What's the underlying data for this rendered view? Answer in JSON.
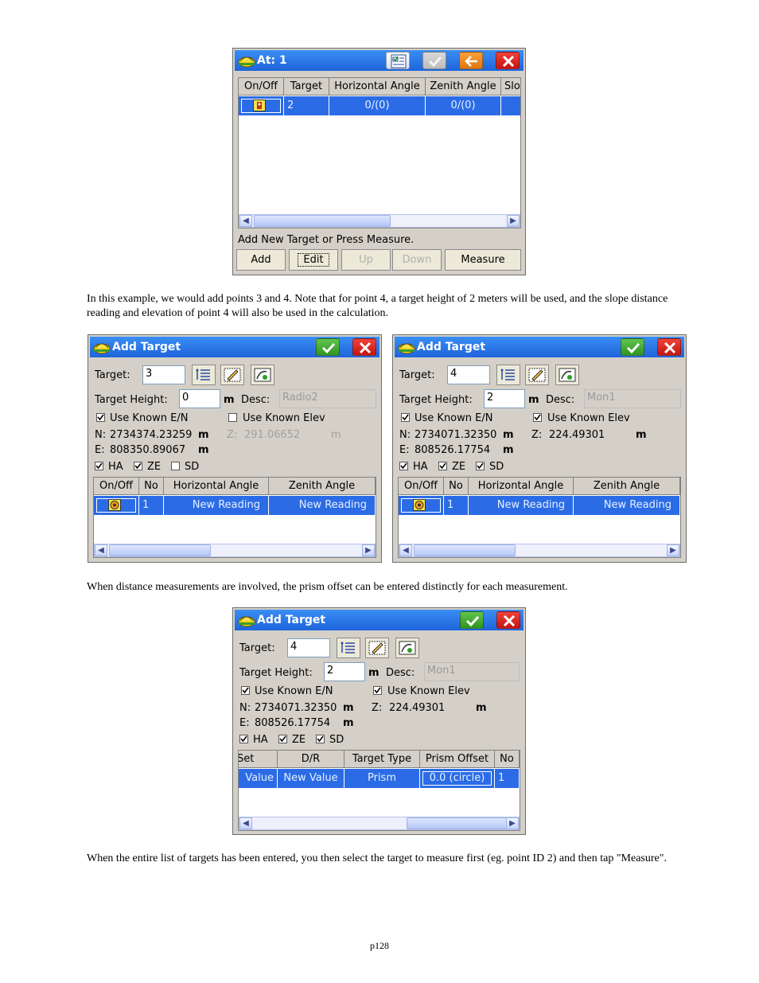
{
  "win1": {
    "title": "At: 1",
    "grid_headers": [
      "On/Off",
      "Target",
      "Horizontal Angle",
      "Zenith Angle",
      "Slo"
    ],
    "row": {
      "target": "2",
      "horizontal_angle": "0/(0)",
      "zenith_angle": "0/(0)"
    },
    "status_text": "Add New Target or Press Measure.",
    "buttons": {
      "add": "Add",
      "edit": "Edit",
      "up": "Up",
      "down": "Down",
      "measure": "Measure"
    }
  },
  "para1": "In this example, we would add points 3 and 4.  Note that for point 4, a target height of 2 meters will be used, and the slope distance reading and elevation of point 4 will also be used in the calculation.",
  "labels": {
    "window_title": "Add Target",
    "target": "Target:",
    "target_height": "Target Height:",
    "unit_m": "m",
    "desc": "Desc:",
    "use_known_en": "Use Known E/N",
    "use_known_elev": "Use Known Elev",
    "n": "N:",
    "e": "E:",
    "z": "Z:",
    "ha": "HA",
    "ze": "ZE",
    "sd": "SD",
    "grid_headers": [
      "On/Off",
      "No",
      "Horizontal Angle",
      "Zenith Angle"
    ]
  },
  "win2": {
    "target": "3",
    "target_height": "0",
    "desc": "Radio2",
    "n_value": "2734374.23259",
    "e_value": "808350.89067",
    "z_value": "291.06652",
    "row": {
      "no": "1",
      "horizontal_angle": "New Reading",
      "zenith_angle": "New Reading"
    }
  },
  "win3": {
    "target": "4",
    "target_height": "2",
    "desc": "Mon1",
    "n_value": "2734071.32350",
    "e_value": "808526.17754",
    "z_value": "224.49301",
    "row": {
      "no": "1",
      "horizontal_angle": "New Reading",
      "zenith_angle": "New Reading"
    }
  },
  "para2": "When distance measurements are involved, the prism offset can be entered distinctly for each measurement.",
  "win4": {
    "target": "4",
    "target_height": "2",
    "desc": "Mon1",
    "n_value": "2734071.32350",
    "e_value": "808526.17754",
    "z_value": "224.49301",
    "grid_headers": [
      "Set",
      "D/R",
      "Target Type",
      "Prism Offset",
      "No"
    ],
    "row": {
      "set": "Value",
      "dr": "New Value",
      "target_type": "Prism",
      "prism_offset": "0.0 (circle)",
      "no": "1"
    }
  },
  "para3": "When the entire list of targets has been entered, you then select the target to measure first (eg. point ID 2) and then tap \"Measure\".",
  "page_number": "p128",
  "icons": [
    "hardhat-logo-icon",
    "calculator-icon",
    "check-icon",
    "back-arrow-icon",
    "close-icon",
    "list-icon",
    "edit-icon",
    "instrument-icon",
    "target-icon"
  ],
  "colors": {
    "title_bar": "#1e64db",
    "selection": "#2b6ce6",
    "ok_button": "#2f9420",
    "close_button": "#c41610",
    "back_button": "#e07510"
  }
}
